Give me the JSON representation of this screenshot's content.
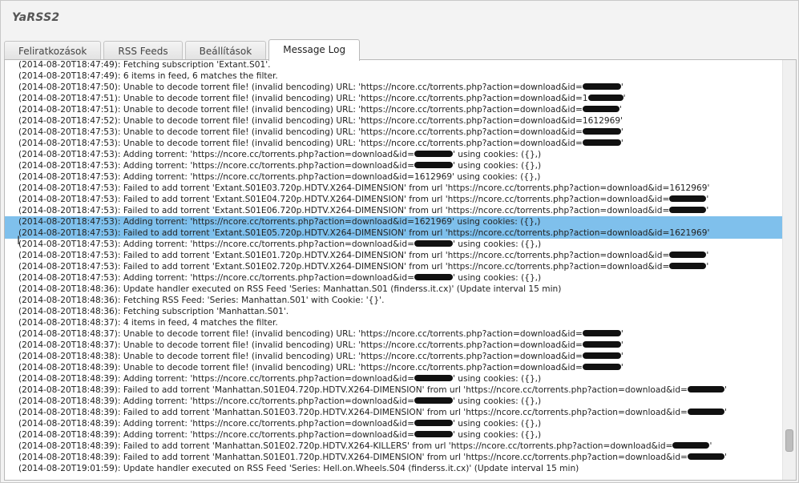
{
  "app": {
    "title": "YaRSS2"
  },
  "tabs": [
    {
      "label": "Feliratkozások",
      "active": false
    },
    {
      "label": "RSS Feeds",
      "active": false
    },
    {
      "label": "Beállítások",
      "active": false
    },
    {
      "label": "Message Log",
      "active": true
    }
  ],
  "log": {
    "lines": [
      {
        "text": "(2014-08-20T18:47:49): Fetching subscription 'Extant.S01'.",
        "redact_width": 0
      },
      {
        "text": "(2014-08-20T18:47:49): 6 items in feed, 6 matches the filter.",
        "redact_width": 0
      },
      {
        "text": "(2014-08-20T18:47:50): Unable to decode torrent file! (invalid bencoding) URL: 'https://ncore.cc/torrents.php?action=download&id=",
        "suffix": "'",
        "redact_width": 48
      },
      {
        "text": "(2014-08-20T18:47:51): Unable to decode torrent file! (invalid bencoding) URL: 'https://ncore.cc/torrents.php?action=download&id=1",
        "suffix": "'",
        "redact_width": 44
      },
      {
        "text": "(2014-08-20T18:47:51): Unable to decode torrent file! (invalid bencoding) URL: 'https://ncore.cc/torrents.php?action=download&id=",
        "suffix": "'",
        "redact_width": 46
      },
      {
        "text": "(2014-08-20T18:47:52): Unable to decode torrent file! (invalid bencoding) URL: 'https://ncore.cc/torrents.php?action=download&id=1612969'",
        "redact_width": 0
      },
      {
        "text": "(2014-08-20T18:47:53): Unable to decode torrent file! (invalid bencoding) URL: 'https://ncore.cc/torrents.php?action=download&id=",
        "suffix": "'",
        "redact_width": 48
      },
      {
        "text": "(2014-08-20T18:47:53): Unable to decode torrent file! (invalid bencoding) URL: 'https://ncore.cc/torrents.php?action=download&id=",
        "suffix": "'",
        "redact_width": 48
      },
      {
        "text": "(2014-08-20T18:47:53): Adding torrent: 'https://ncore.cc/torrents.php?action=download&id=",
        "suffix": "' using cookies: ({},)",
        "redact_width": 48
      },
      {
        "text": "(2014-08-20T18:47:53): Adding torrent: 'https://ncore.cc/torrents.php?action=download&id=",
        "suffix": "' using cookies: ({},)",
        "redact_width": 48
      },
      {
        "text": "(2014-08-20T18:47:53): Adding torrent: 'https://ncore.cc/torrents.php?action=download&id=1612969' using cookies: ({},)",
        "redact_width": 0
      },
      {
        "text": "(2014-08-20T18:47:53): Failed to add torrent 'Extant.S01E03.720p.HDTV.X264-DIMENSION' from url 'https://ncore.cc/torrents.php?action=download&id=1612969'",
        "redact_width": 0
      },
      {
        "text": "(2014-08-20T18:47:53): Failed to add torrent 'Extant.S01E04.720p.HDTV.X264-DIMENSION' from url 'https://ncore.cc/torrents.php?action=download&id=",
        "suffix": "'",
        "redact_width": 46
      },
      {
        "text": "(2014-08-20T18:47:53): Failed to add torrent 'Extant.S01E06.720p.HDTV.X264-DIMENSION' from url 'https://ncore.cc/torrents.php?action=download&id=",
        "suffix": "'",
        "redact_width": 46
      },
      {
        "text": "(2014-08-20T18:47:53): Adding torrent: 'https://ncore.cc/torrents.php?action=download&id=1621969' using cookies: ({},)",
        "redact_width": 0,
        "selected": true
      },
      {
        "text": "(2014-08-20T18:47:53): Failed to add torrent 'Extant.S01E05.720p.HDTV.X264-DIMENSION' from url 'https://ncore.cc/torrents.php?action=download&id=1621969'",
        "redact_width": 0,
        "selected": true
      },
      {
        "text": "(2014-08-20T18:47:53): Adding torrent: 'https://ncore.cc/torrents.php?action=download&id=",
        "suffix": "' using cookies: ({},)",
        "redact_width": 48
      },
      {
        "text": "(2014-08-20T18:47:53): Failed to add torrent 'Extant.S01E01.720p.HDTV.X264-DIMENSION' from url 'https://ncore.cc/torrents.php?action=download&id=",
        "suffix": "'",
        "redact_width": 46
      },
      {
        "text": "(2014-08-20T18:47:53): Failed to add torrent 'Extant.S01E02.720p.HDTV.X264-DIMENSION' from url 'https://ncore.cc/torrents.php?action=download&id=",
        "suffix": "'",
        "redact_width": 46
      },
      {
        "text": "(2014-08-20T18:47:53): Adding torrent: 'https://ncore.cc/torrents.php?action=download&id=",
        "suffix": "' using cookies: ({},)",
        "redact_width": 48
      },
      {
        "text": "(2014-08-20T18:48:36): Update handler executed on RSS Feed 'Series: Manhattan.S01 (finderss.it.cx)' (Update interval 15 min)",
        "redact_width": 0
      },
      {
        "text": "(2014-08-20T18:48:36): Fetching RSS Feed: 'Series: Manhattan.S01' with Cookie: '{}'.",
        "redact_width": 0
      },
      {
        "text": "(2014-08-20T18:48:36): Fetching subscription 'Manhattan.S01'.",
        "redact_width": 0
      },
      {
        "text": "(2014-08-20T18:48:37): 4 items in feed, 4 matches the filter.",
        "redact_width": 0
      },
      {
        "text": "(2014-08-20T18:48:37): Unable to decode torrent file! (invalid bencoding) URL: 'https://ncore.cc/torrents.php?action=download&id=",
        "suffix": "'",
        "redact_width": 48
      },
      {
        "text": "(2014-08-20T18:48:37): Unable to decode torrent file! (invalid bencoding) URL: 'https://ncore.cc/torrents.php?action=download&id=",
        "suffix": "'",
        "redact_width": 48
      },
      {
        "text": "(2014-08-20T18:48:38): Unable to decode torrent file! (invalid bencoding) URL: 'https://ncore.cc/torrents.php?action=download&id=",
        "suffix": "'",
        "redact_width": 48
      },
      {
        "text": "(2014-08-20T18:48:39): Unable to decode torrent file! (invalid bencoding) URL: 'https://ncore.cc/torrents.php?action=download&id=",
        "suffix": "'",
        "redact_width": 48
      },
      {
        "text": "(2014-08-20T18:48:39): Adding torrent: 'https://ncore.cc/torrents.php?action=download&id=",
        "suffix": "' using cookies: ({},)",
        "redact_width": 48
      },
      {
        "text": "(2014-08-20T18:48:39): Failed to add torrent 'Manhattan.S01E04.720p.HDTV.X264-DIMENSION' from url 'https://ncore.cc/torrents.php?action=download&id=",
        "suffix": "'",
        "redact_width": 46
      },
      {
        "text": "(2014-08-20T18:48:39): Adding torrent: 'https://ncore.cc/torrents.php?action=download&id=",
        "suffix": "' using cookies: ({},)",
        "redact_width": 48
      },
      {
        "text": "(2014-08-20T18:48:39): Failed to add torrent 'Manhattan.S01E03.720p.HDTV.X264-DIMENSION' from url 'https://ncore.cc/torrents.php?action=download&id=",
        "suffix": "'",
        "redact_width": 46
      },
      {
        "text": "(2014-08-20T18:48:39): Adding torrent: 'https://ncore.cc/torrents.php?action=download&id=",
        "suffix": "' using cookies: ({},)",
        "redact_width": 48
      },
      {
        "text": "(2014-08-20T18:48:39): Adding torrent: 'https://ncore.cc/torrents.php?action=download&id=",
        "suffix": "' using cookies: ({},)",
        "redact_width": 48
      },
      {
        "text": "(2014-08-20T18:48:39): Failed to add torrent 'Manhattan.S01E02.720p.HDTV.X264-KILLERS' from url 'https://ncore.cc/torrents.php?action=download&id=",
        "suffix": "'",
        "redact_width": 46
      },
      {
        "text": "(2014-08-20T18:48:39): Failed to add torrent 'Manhattan.S01E01.720p.HDTV.X264-DIMENSION' from url 'https://ncore.cc/torrents.php?action=download&id=",
        "suffix": "'",
        "redact_width": 46
      },
      {
        "text": "(2014-08-20T19:01:59): Update handler executed on RSS Feed 'Series: Hell.on.Wheels.S04 (finderss.it.cx)' (Update interval 15 min)",
        "redact_width": 0
      }
    ]
  },
  "scrollbar": {
    "position": 0.92
  }
}
